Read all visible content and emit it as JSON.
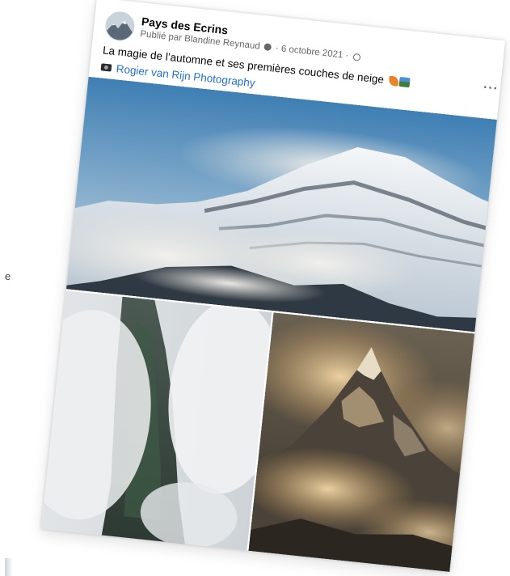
{
  "edge_fragment": "e",
  "post": {
    "page_name": "Pays des Ecrins",
    "published_by": "Publié par Blandine Reynaud",
    "separator": "·",
    "date": "6 octobre 2021",
    "caption": "La magie de l’automne et ses premières couches de neige",
    "credit_link": "Rogier van Rijn Photography",
    "more_label": "···"
  },
  "icons": {
    "avatar": "avatar",
    "info": "info-dot-icon",
    "audience": "globe-icon",
    "camera": "camera-icon",
    "leaf_emoji": "leaf-icon",
    "mountain_emoji": "mountain-icon",
    "more": "more-options-icon"
  },
  "colors": {
    "link": "#216fdb",
    "name": "#050505",
    "meta": "#65676b"
  }
}
